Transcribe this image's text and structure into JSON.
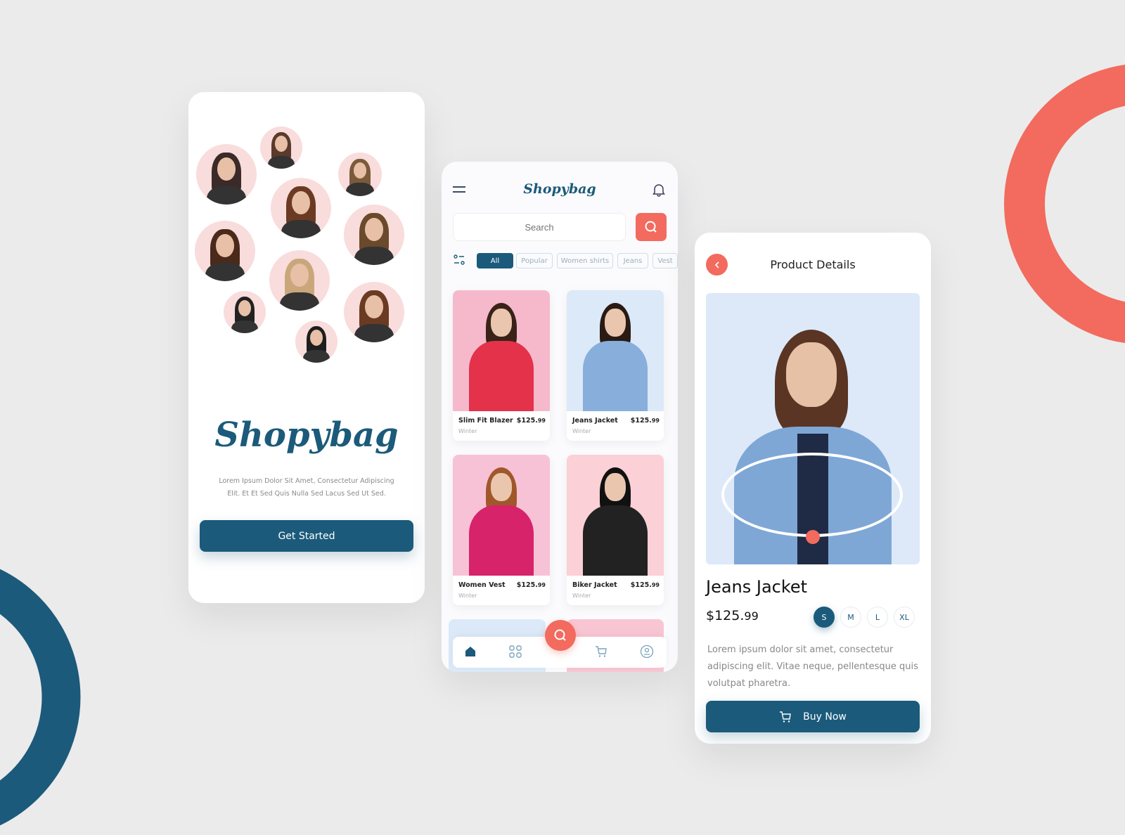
{
  "colors": {
    "primary": "#1b5a7a",
    "accent": "#f26b5e",
    "background": "#ebebeb"
  },
  "welcome": {
    "logo": "Shopybag",
    "description_line1": "Lorem Ipsum Dolor Sit Amet, Consectetur Adipiscing",
    "description_line2": "Elit. Et Et Sed Quis Nulla Sed Lacus Sed Ut Sed.",
    "cta": "Get Started"
  },
  "home": {
    "logo": "Shopybag",
    "search_placeholder": "Search",
    "icons": {
      "menu": "hamburger-icon",
      "notifications": "bell-icon",
      "search": "search-icon",
      "filter": "filter-icon"
    },
    "chips": [
      {
        "label": "All",
        "active": true
      },
      {
        "label": "Popular"
      },
      {
        "label": "Women shirts"
      },
      {
        "label": "Jeans"
      },
      {
        "label": "Vest"
      }
    ],
    "products": [
      {
        "name": "Slim Fit Blazer",
        "price": "$125.",
        "cents": "99",
        "season": "Winter"
      },
      {
        "name": "Jeans Jacket",
        "price": "$125.",
        "cents": "99",
        "season": "Winter"
      },
      {
        "name": "Women Vest",
        "price": "$125.",
        "cents": "99",
        "season": "Winter"
      },
      {
        "name": "Biker Jacket",
        "price": "$125.",
        "cents": "99",
        "season": "Winter"
      }
    ],
    "nav": [
      "home-icon",
      "grid-icon",
      "search-icon",
      "cart-icon",
      "profile-icon"
    ]
  },
  "details": {
    "title": "Product Details",
    "name": "Jeans Jacket",
    "price": "$125.",
    "cents": "99",
    "sizes": [
      "S",
      "M",
      "L",
      "XL"
    ],
    "selected_size": "S",
    "description": "Lorem ipsum dolor sit amet, consectetur adipiscing elit. Vitae neque, pellentesque quis volutpat pharetra.",
    "buy": "Buy Now"
  }
}
